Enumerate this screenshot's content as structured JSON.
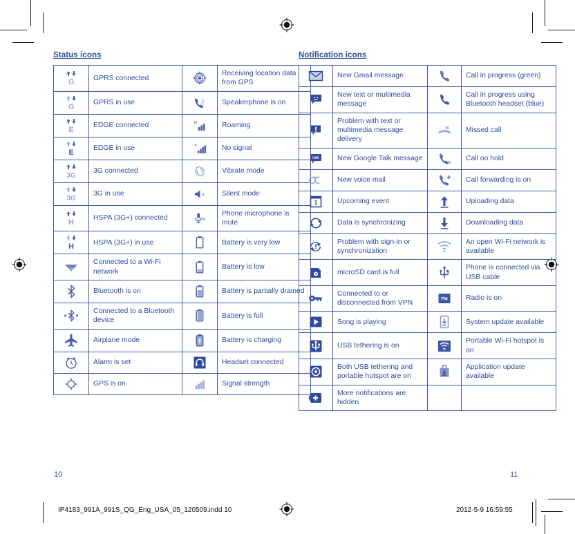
{
  "document": {
    "left_page_number": "10",
    "right_page_number": "11",
    "slug_filename": "IP4183_991A_991S_QG_Eng_USA_05_120509.indd   10",
    "slug_datetime": "2012-5-9   16:59:55",
    "accent_color": "#2b4b9b",
    "border_color": "#3a5ba8",
    "icon_color": "#4a5fa8",
    "icon_color_light": "#9aa6d4"
  },
  "status_section": {
    "title": "Status icons",
    "rows": [
      {
        "left": {
          "icon": "gprs-connected-icon",
          "label": "GPRS connected"
        },
        "right": {
          "icon": "gps-receiving-icon",
          "label": "Receiving location data from GPS"
        }
      },
      {
        "left": {
          "icon": "gprs-in-use-icon",
          "label": "GPRS in use"
        },
        "right": {
          "icon": "speakerphone-icon",
          "label": "Speakerphone is on"
        }
      },
      {
        "left": {
          "icon": "edge-connected-icon",
          "label": "EDGE connected"
        },
        "right": {
          "icon": "roaming-icon",
          "label": "Roaming"
        }
      },
      {
        "left": {
          "icon": "edge-in-use-icon",
          "label": "EDGE in use"
        },
        "right": {
          "icon": "no-signal-icon",
          "label": "No signal"
        }
      },
      {
        "left": {
          "icon": "3g-connected-icon",
          "label": "3G connected"
        },
        "right": {
          "icon": "vibrate-mode-icon",
          "label": "Vibrate mode"
        }
      },
      {
        "left": {
          "icon": "3g-in-use-icon",
          "label": "3G in use"
        },
        "right": {
          "icon": "silent-mode-icon",
          "label": "Silent mode"
        }
      },
      {
        "left": {
          "icon": "hspa-connected-icon",
          "label": "HSPA (3G+) connected"
        },
        "right": {
          "icon": "microphone-mute-icon",
          "label": "Phone microphone is mute"
        }
      },
      {
        "left": {
          "icon": "hspa-in-use-icon",
          "label": "HSPA (3G+) in use"
        },
        "right": {
          "icon": "battery-very-low-icon",
          "label": "Battery is very low"
        }
      },
      {
        "left": {
          "icon": "wifi-connected-icon",
          "label": "Connected to a Wi-Fi network"
        },
        "right": {
          "icon": "battery-low-icon",
          "label": "Battery is low"
        }
      },
      {
        "left": {
          "icon": "bluetooth-on-icon",
          "label": "Bluetooth is on"
        },
        "right": {
          "icon": "battery-partial-icon",
          "label": "Battery is partially drained"
        }
      },
      {
        "left": {
          "icon": "bluetooth-connected-icon",
          "label": "Connected to a Bluetooth device"
        },
        "right": {
          "icon": "battery-full-icon",
          "label": "Battery is full"
        }
      },
      {
        "left": {
          "icon": "airplane-mode-icon",
          "label": "Airplane mode"
        },
        "right": {
          "icon": "battery-charging-icon",
          "label": "Battery is charging"
        }
      },
      {
        "left": {
          "icon": "alarm-icon",
          "label": "Alarm is set"
        },
        "right": {
          "icon": "headset-icon",
          "label": "Headset connected"
        }
      },
      {
        "left": {
          "icon": "gps-on-icon",
          "label": "GPS is on"
        },
        "right": {
          "icon": "signal-strength-icon",
          "label": "Signal strength"
        }
      }
    ]
  },
  "notification_section": {
    "title": "Notification icons",
    "rows": [
      {
        "left": {
          "icon": "gmail-icon",
          "label": "New Gmail message"
        },
        "right": {
          "icon": "call-in-progress-icon",
          "label": "Call in progress (green)"
        }
      },
      {
        "left": {
          "icon": "sms-message-icon",
          "label": "New text or multimedia message"
        },
        "right": {
          "icon": "call-bluetooth-icon",
          "label": "Call in progress using Bluetooth headset (blue)"
        }
      },
      {
        "left": {
          "icon": "message-problem-icon",
          "label": "Problem with text or multimedia message delivery"
        },
        "right": {
          "icon": "missed-call-icon",
          "label": "Missed call"
        }
      },
      {
        "left": {
          "icon": "google-talk-icon",
          "label": "New Google Talk message"
        },
        "right": {
          "icon": "call-on-hold-icon",
          "label": "Call on hold"
        }
      },
      {
        "left": {
          "icon": "voicemail-icon",
          "label": "New voice mail"
        },
        "right": {
          "icon": "call-forwarding-icon",
          "label": "Call forwarding is on"
        }
      },
      {
        "left": {
          "icon": "calendar-event-icon",
          "label": "Upcoming event"
        },
        "right": {
          "icon": "upload-icon",
          "label": "Uploading data"
        }
      },
      {
        "left": {
          "icon": "sync-icon",
          "label": "Data is synchronizing"
        },
        "right": {
          "icon": "download-icon",
          "label": "Downloading data"
        }
      },
      {
        "left": {
          "icon": "sync-problem-icon",
          "label": "Problem with sign-in or synchronization"
        },
        "right": {
          "icon": "wifi-open-network-icon",
          "label": "An open Wi-Fi network is available"
        }
      },
      {
        "left": {
          "icon": "sdcard-full-icon",
          "label": "microSD card is full"
        },
        "right": {
          "icon": "usb-cable-icon",
          "label": "Phone is connected via USB cable"
        }
      },
      {
        "left": {
          "icon": "vpn-icon",
          "label": "Connected to or disconnected from VPN"
        },
        "right": {
          "icon": "fm-radio-icon",
          "label": "Radio is on"
        }
      },
      {
        "left": {
          "icon": "play-song-icon",
          "label": "Song is playing"
        },
        "right": {
          "icon": "system-update-icon",
          "label": "System update available"
        }
      },
      {
        "left": {
          "icon": "usb-tethering-icon",
          "label": "USB tethering is on"
        },
        "right": {
          "icon": "wifi-hotspot-icon",
          "label": "Portable Wi-Fi hotspot is on"
        }
      },
      {
        "left": {
          "icon": "tethering-hotspot-icon",
          "label": "Both USB tethering and portable hotspot are on"
        },
        "right": {
          "icon": "app-update-icon",
          "label": "Application update available"
        }
      },
      {
        "left": {
          "icon": "more-notifications-icon",
          "label": "More notifications are hidden"
        },
        "right": {
          "icon": "",
          "label": ""
        }
      }
    ]
  }
}
